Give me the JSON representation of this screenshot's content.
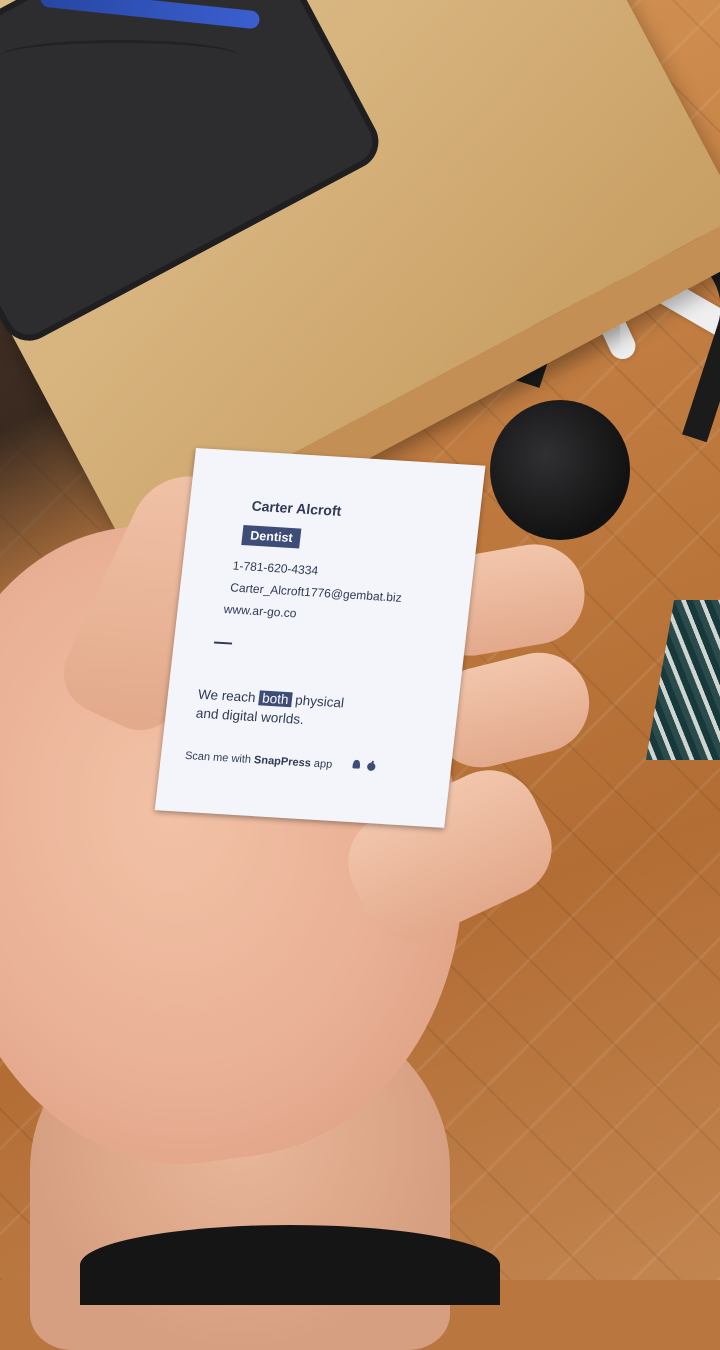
{
  "card": {
    "name": "Carter Alcroft",
    "title": "Dentist",
    "phone": "1-781-620-4334",
    "email": "Carter_Alcroft1776@gembat.biz",
    "website": "www.ar-go.co",
    "tagline_pre": "We reach",
    "tagline_highlight": "both",
    "tagline_post": "physical",
    "tagline_line2": "and digital worlds.",
    "scan_pre": "Scan me with",
    "scan_app": "SnapPress",
    "scan_post": "app",
    "icons": [
      "android-icon",
      "apple-icon"
    ],
    "accent_color": "#3d4d77"
  }
}
